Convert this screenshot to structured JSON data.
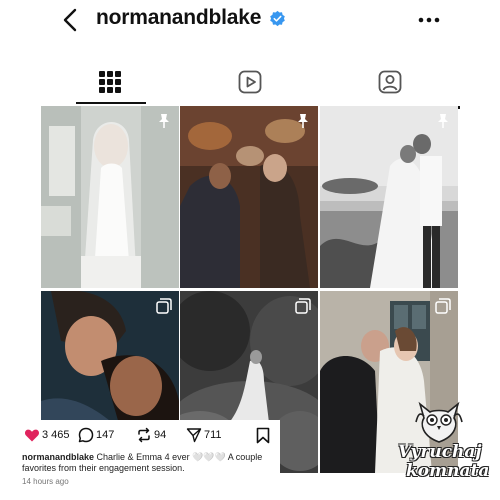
{
  "header": {
    "username": "normanandblake",
    "back_icon": "chevron-left-icon",
    "verified_icon": "verified-badge-icon",
    "more_icon": "more-horizontal-icon"
  },
  "tabs": [
    {
      "name": "grid",
      "icon": "grid-icon",
      "active": true
    },
    {
      "name": "reels",
      "icon": "reels-icon",
      "active": false
    },
    {
      "name": "tagged",
      "icon": "tagged-user-icon",
      "active": false
    }
  ],
  "grid": {
    "posts": [
      {
        "badge": "pin-icon"
      },
      {
        "badge": "pin-icon"
      },
      {
        "badge": "pin-icon"
      },
      {
        "badge": "carousel-icon"
      },
      {
        "badge": "carousel-icon"
      },
      {
        "badge": "carousel-icon"
      }
    ]
  },
  "post": {
    "likes": "3 465",
    "comments": "147",
    "reposts": "94",
    "shares": "711",
    "caption_user": "normanandblake",
    "caption_text": "Charlie & Emma 4 ever 🤍🤍🤍 A couple favorites from their engagement session.",
    "timestamp": "14 hours ago"
  },
  "watermark": {
    "line1": "Vyruchaj",
    "line2": "komnata"
  },
  "colors": {
    "accent_blue": "#3897f0",
    "like_red": "#e0245e",
    "text": "#111111"
  }
}
